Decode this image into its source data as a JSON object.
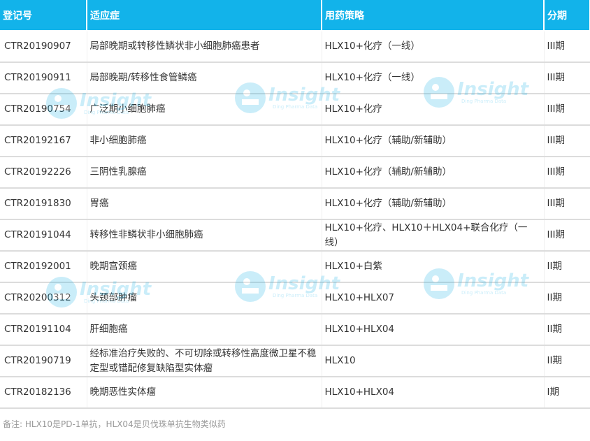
{
  "table": {
    "headers": [
      "登记号",
      "适应症",
      "用药策略",
      "分期"
    ],
    "rows": [
      [
        "CTR20190907",
        "局部晚期或转移性鳞状非小细胞肺癌患者",
        "HLX10+化疗（一线）",
        "III期"
      ],
      [
        "CTR20190911",
        "局部晚期/转移性食管鳞癌",
        "HLX10+化疗（一线）",
        "III期"
      ],
      [
        "CTR20190754",
        "广泛期小细胞肺癌",
        "HLX10+化疗",
        "III期"
      ],
      [
        "CTR20192167",
        "非小细胞肺癌",
        "HLX10+化疗（辅助/新辅助）",
        "III期"
      ],
      [
        "CTR20192226",
        "三阴性乳腺癌",
        "HLX10+化疗（辅助/新辅助）",
        "III期"
      ],
      [
        "CTR20191830",
        "胃癌",
        "HLX10+化疗（辅助/新辅助）",
        "III期"
      ],
      [
        "CTR20191044",
        "转移性非鳞状非小细胞肺癌",
        "HLX10+化疗、HLX10＋HLX04+联合化疗（一线）",
        "III期"
      ],
      [
        "CTR20192001",
        "晚期宫颈癌",
        "HLX10+白紫",
        "II期"
      ],
      [
        "CTR20200312",
        "头颈部肿瘤",
        "HLX10+HLX07",
        "II期"
      ],
      [
        "CTR20191104",
        "肝细胞癌",
        "HLX10+HLX04",
        "II期"
      ],
      [
        "CTR20190719",
        "经标准治疗失败的、不可切除或转移性高度微卫星不稳定型或错配修复缺陷型实体瘤",
        "HLX10",
        "II期"
      ],
      [
        "CTR20182136",
        "晚期恶性实体瘤",
        "HLX10+HLX04",
        "I期"
      ]
    ]
  },
  "footnote": "备注: HLX10是PD-1单抗，HLX04是贝伐珠单抗生物类似药",
  "watermark": {
    "brand": "Insight",
    "sub": "Ding Pharma Data",
    "icon": "insight-logo-icon"
  },
  "colors": {
    "header_bg": "#12b3ea",
    "header_text": "#ffffff",
    "row_divider": "#dcdcdc",
    "footnote_text": "#999999"
  }
}
